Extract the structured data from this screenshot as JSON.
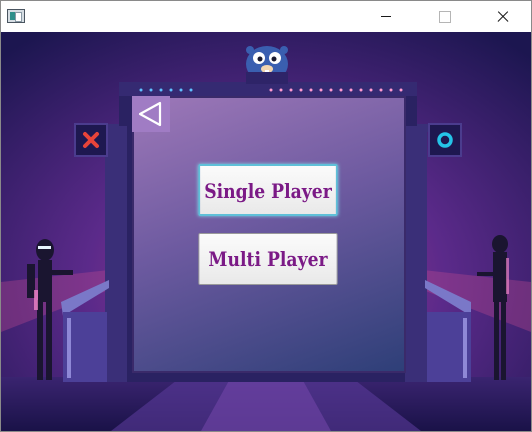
{
  "window": {
    "title": "",
    "controls": [
      "minimize-icon",
      "maximize-icon",
      "close-icon"
    ]
  },
  "menu": {
    "back_icon": "back-triangle-icon",
    "single_player_label": "Single Player",
    "multi_player_label": "Multi Player"
  },
  "scene": {
    "left_symbol": "x-icon",
    "right_symbol": "o-icon",
    "mascot": "gopher-icon"
  },
  "colors": {
    "accent_text": "#7b1a86",
    "focus_border": "#5fc0d8",
    "x_color": "#e8443a",
    "o_color": "#25c4e8"
  }
}
